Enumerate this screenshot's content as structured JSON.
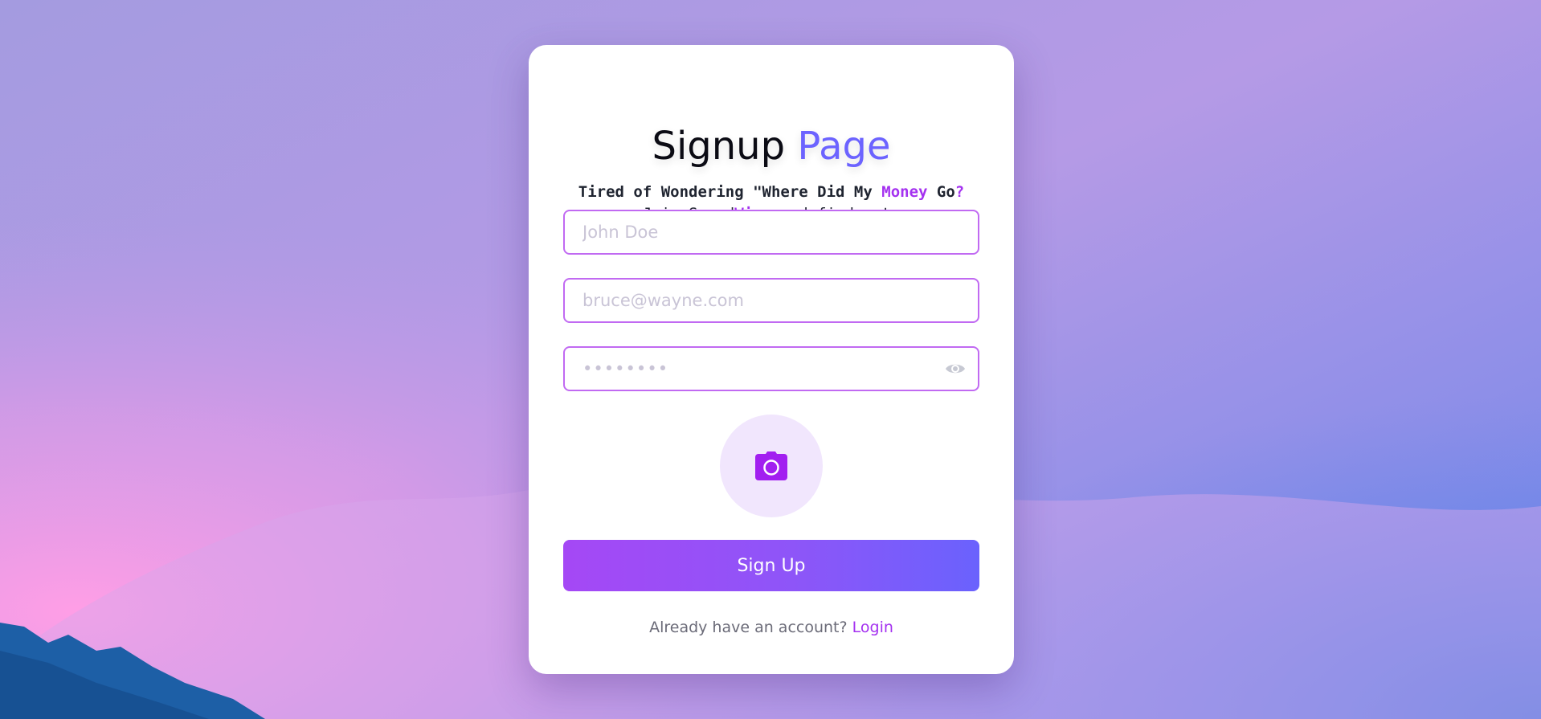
{
  "colors": {
    "accent": "#6c63ff",
    "brand_purple": "#a431f0",
    "input_border": "#c16af2",
    "button_gradient_start": "#a548f5",
    "button_gradient_end": "#6a62fd"
  },
  "header": {
    "title_main": "Signup",
    "title_accent": "Page"
  },
  "tagline": {
    "line1_a": "Tired of Wondering \"Where Did My ",
    "line1_highlight": "Money",
    "line1_b": " Go",
    "line1_mark": "?",
    "line2_a": "Join Spend",
    "line2_highlight": "Wise",
    "line2_b": " and find out",
    "line2_mark": "."
  },
  "form": {
    "name": {
      "placeholder": "John Doe",
      "value": ""
    },
    "email": {
      "placeholder": "bruce@wayne.com",
      "value": ""
    },
    "password": {
      "placeholder": "••••••••",
      "value": "",
      "toggle_icon": "eye-icon"
    },
    "photo": {
      "icon": "camera-icon"
    },
    "submit_label": "Sign Up"
  },
  "footer": {
    "prompt": "Already have an account?",
    "link_label": "Login"
  }
}
